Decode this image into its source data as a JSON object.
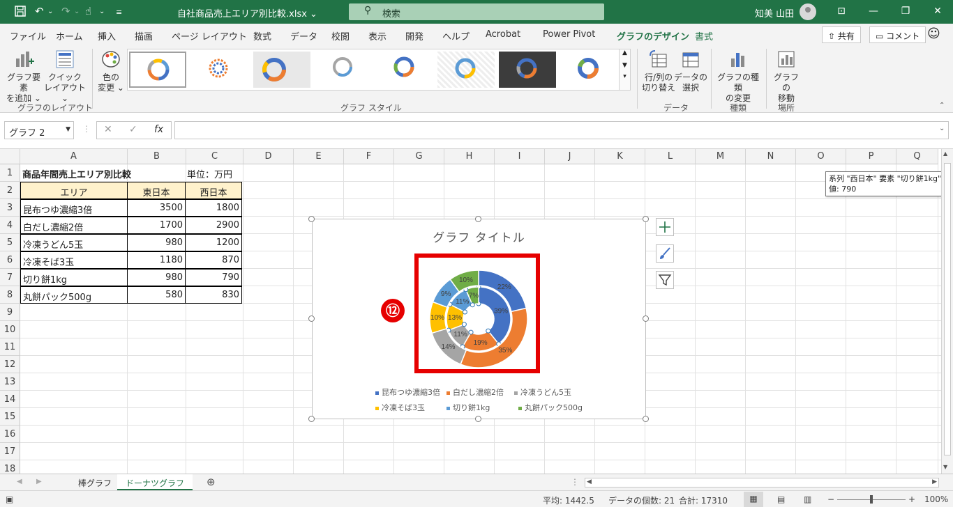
{
  "titlebar": {
    "doc_title": "自社商品売上エリア別比較.xlsx ⌄",
    "search_placeholder": "検索",
    "user_name": "知美 山田"
  },
  "tabs": [
    {
      "label": "ファイル"
    },
    {
      "label": "ホーム"
    },
    {
      "label": "挿入"
    },
    {
      "label": "描画"
    },
    {
      "label": "ページ レイアウト"
    },
    {
      "label": "数式"
    },
    {
      "label": "データ"
    },
    {
      "label": "校閲"
    },
    {
      "label": "表示"
    },
    {
      "label": "開発"
    },
    {
      "label": "ヘルプ"
    },
    {
      "label": "Acrobat"
    },
    {
      "label": "Power Pivot"
    },
    {
      "label": "グラフのデザイン"
    },
    {
      "label": "書式"
    }
  ],
  "share_label": "共有",
  "comment_label": "コメント",
  "ribbon": {
    "add_element": [
      "グラフ要素",
      "を追加 ⌄"
    ],
    "quick_layout": [
      "クイック",
      "レイアウト ⌄"
    ],
    "layout_group": "グラフのレイアウト",
    "color_change": [
      "色の",
      "変更 ⌄"
    ],
    "styles_group": "グラフ スタイル",
    "switch_rowcol": [
      "行/列の",
      "切り替え"
    ],
    "select_data": [
      "データの",
      "選択"
    ],
    "data_group": "データ",
    "change_type": [
      "グラフの種類",
      "の変更"
    ],
    "type_group": "種類",
    "move_chart": [
      "グラフの",
      "移動"
    ],
    "location_group": "場所"
  },
  "formula": {
    "name_box": "グラフ 2",
    "value": ""
  },
  "columns": [
    "A",
    "B",
    "C",
    "D",
    "E",
    "F",
    "G",
    "H",
    "I",
    "J",
    "K",
    "L",
    "M",
    "N",
    "O",
    "P",
    "Q"
  ],
  "rows": [
    "1",
    "2",
    "3",
    "4",
    "5",
    "6",
    "7",
    "8",
    "9",
    "10",
    "11",
    "12",
    "13",
    "14",
    "15",
    "16",
    "17",
    "18"
  ],
  "sheet": {
    "a1": "商品年間売上エリア別比較",
    "c1": "単位：万円",
    "headers": [
      "エリア",
      "東日本",
      "西日本"
    ],
    "data": [
      {
        "name": "昆布つゆ濃縮3倍",
        "east": "3500",
        "west": "1800"
      },
      {
        "name": "白だし濃縮2倍",
        "east": "1700",
        "west": "2900"
      },
      {
        "name": "冷凍うどん5玉",
        "east": "980",
        "west": "1200"
      },
      {
        "name": "冷凍そば3玉",
        "east": "1180",
        "west": "870"
      },
      {
        "name": "切り餅1kg",
        "east": "980",
        "west": "790"
      },
      {
        "name": "丸餅パック500g",
        "east": "580",
        "west": "830"
      }
    ]
  },
  "chart_data": {
    "type": "donut",
    "title": "グラフ タイトル",
    "categories": [
      "昆布つゆ濃縮3倍",
      "白だし濃縮2倍",
      "冷凍うどん5玉",
      "冷凍そば3玉",
      "切り餅1kg",
      "丸餅パック500g"
    ],
    "colors": [
      "#4472c4",
      "#ed7d31",
      "#a5a5a5",
      "#ffc000",
      "#5b9bd5",
      "#70ad47"
    ],
    "series": [
      {
        "name": "東日本",
        "values": [
          3500,
          1700,
          980,
          1180,
          980,
          580
        ]
      },
      {
        "name": "西日本",
        "values": [
          1800,
          2900,
          1200,
          870,
          790,
          830
        ]
      }
    ],
    "inner_labels": [
      "39%",
      "19%",
      "11%",
      "13%",
      "11%",
      "7%"
    ],
    "outer_labels": [
      "22%",
      "35%",
      "14%",
      "10%",
      "9%",
      "10%"
    ]
  },
  "annotation_marker": "⑫",
  "tooltip": {
    "line1": "系列 \"西日本\" 要素 \"切り餅1kg\"",
    "line2": "値: 790"
  },
  "sheet_tabs": [
    {
      "label": "棒グラフ"
    },
    {
      "label": "ドーナツグラフ"
    }
  ],
  "status": {
    "average": "平均: 1442.5",
    "count": "データの個数: 21",
    "sum": "合計: 17310",
    "zoom": "100%"
  }
}
